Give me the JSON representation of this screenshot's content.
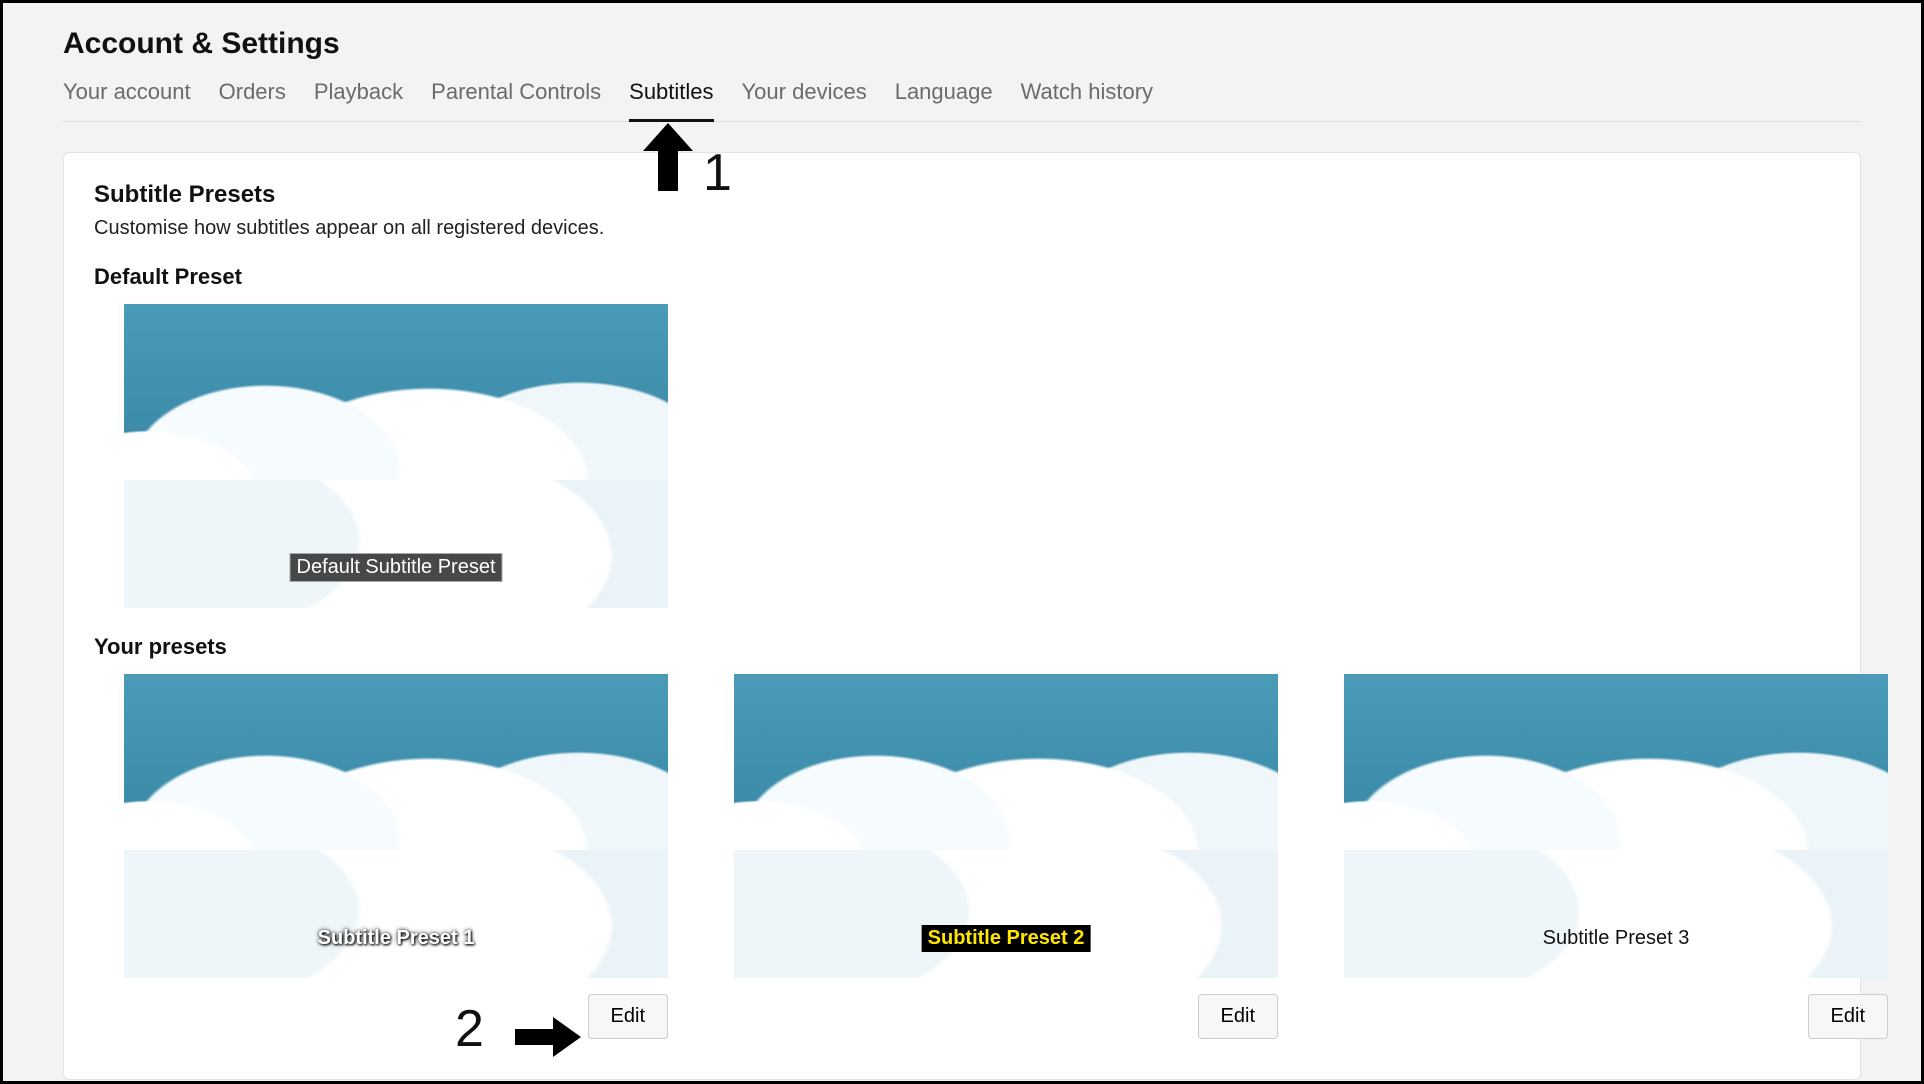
{
  "page_title": "Account & Settings",
  "tabs": {
    "account": "Your account",
    "orders": "Orders",
    "playback": "Playback",
    "parental": "Parental Controls",
    "subtitles": "Subtitles",
    "devices": "Your devices",
    "language": "Language",
    "history": "Watch history"
  },
  "section": {
    "title": "Subtitle Presets",
    "subtitle": "Customise how subtitles appear on all registered devices.",
    "default_heading": "Default Preset",
    "your_heading": "Your presets"
  },
  "presets": {
    "default_caption": "Default Subtitle Preset",
    "p1_caption": "Subtitle Preset 1",
    "p2_caption": "Subtitle Preset 2",
    "p3_caption": "Subtitle Preset 3",
    "edit_label": "Edit"
  },
  "annotations": {
    "n1": "1",
    "n2": "2"
  }
}
